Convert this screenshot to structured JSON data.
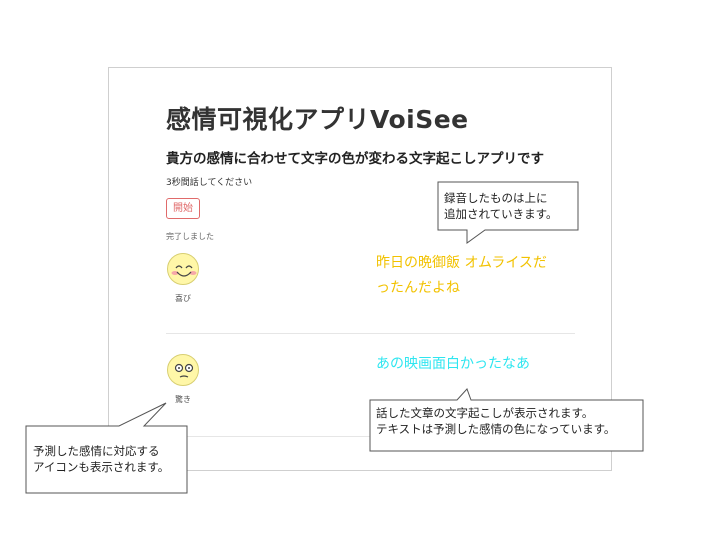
{
  "header": {
    "title": "感情可視化アプリVoiSee",
    "subtitle": "貴方の感情に合わせて文字の色が変わる文字起こしアプリです"
  },
  "recorder": {
    "instruction": "3秒間話してください",
    "start_label": "開始",
    "status": "完了しました"
  },
  "entries": [
    {
      "emotion_label": "喜び",
      "emotion_icon": "happy-face-icon",
      "text_lines": [
        "昨日の晩御飯 オムライスだ",
        "ったんだよね"
      ],
      "text_color": "#f2c200"
    },
    {
      "emotion_label": "驚き",
      "emotion_icon": "surprised-face-icon",
      "text_lines": [
        "あの映画面白かったなあ"
      ],
      "text_color": "#2ee6f0"
    }
  ],
  "annotations": {
    "top_right": [
      "録音したものは上に",
      "追加されていきます。"
    ],
    "bottom_left": [
      "予測した感情に対応する",
      "アイコンも表示されます。"
    ],
    "bottom_right": [
      "話した文章の文字起こしが表示されます。",
      "テキストは予測した感情の色になっています。"
    ]
  },
  "colors": {
    "accent_button": "#e06a6a",
    "face_fill": "#fff7a8"
  }
}
